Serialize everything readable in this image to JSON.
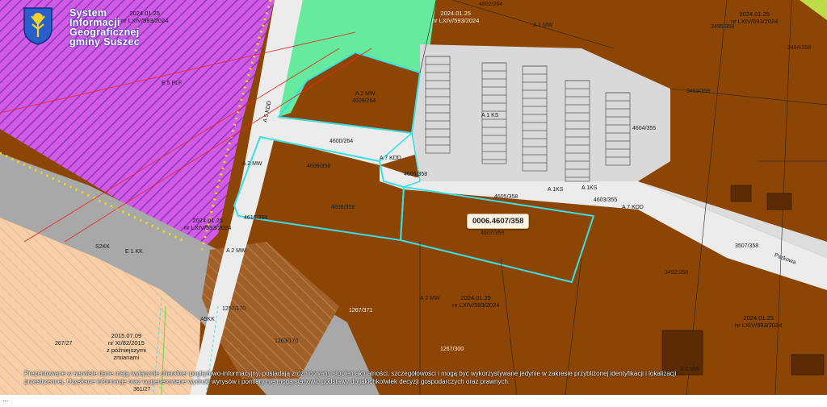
{
  "header": {
    "logo_lines": [
      "System",
      "Informacji",
      "Geograficznej",
      "gminy Suszec"
    ]
  },
  "tooltip": {
    "text": "0006.4607/358"
  },
  "disclaimer": {
    "text": "Prezentowane w serwisie dane mają wyłącznie charakter poglądowo-informacyjny, posiadają zróżnicowany stopień aktualności, szczegółowości i mogą być wykorzystywane jedynie w zakresie przybliżonej identyfikacji i lokalizacji przestrzennej. Uzyskane informacje oraz wygenerowane wydruki wyrysów i pomiary nie mogą stanowić podstawy do jakichkolwiek decyzji gospodarczych oraz prawnych."
  },
  "status": {
    "text": "..."
  },
  "colors": {
    "agricultural_brown": "#8c4504",
    "residential_green": "#66ea9e",
    "parking_gray": "#d9d9d9",
    "road_white": "#ececec",
    "magenta_zone": "#d15be6",
    "salmon_zone": "#f4c7a0",
    "gray_band": "#a9a9a9",
    "parcel_highlight": "#3fe3e6",
    "cyan_outline": "#39dfe4"
  },
  "map_labels": {
    "resolutions": [
      {
        "date": "2024.01.25",
        "ref": "nr LXIV/593/2024"
      },
      {
        "date": "2024.01.25",
        "ref": "nr LXIV/593/2024"
      },
      {
        "date": "2024.01.25",
        "ref": "nr LXIV/593/2024"
      },
      {
        "date": "2024.01.25",
        "ref": "nr LXIV/593/2024"
      },
      {
        "date": "2024.01.25",
        "ref": "nr LXIV/593/2024"
      },
      {
        "date": "2024.01.25",
        "ref": "nr LXIV/593/2024"
      }
    ],
    "old_resolution": {
      "date": "2015.07.09",
      "ref": "nr XI/82/2015",
      "note1": "z późniejszymi",
      "note2": "zmianami"
    },
    "zones": {
      "a1mw_top": "A 1 MW",
      "a2mw": "A 2 MW",
      "a2mw_left": "A 2 MW",
      "a2mw_mid": "A 2 MW",
      "a2mw_bottom": "A 2 MW",
      "a7kdd": "A 7 KDD",
      "a7kdd_right": "A 7 KDD",
      "a1ks": "A 1KS",
      "a1ks_2": "A 1KS",
      "a1ks_3": "A 1 KS",
      "a2mw_right": "A 2 MW",
      "a5kdd": "A 5 KDD",
      "e1kk": "E 1 KK",
      "e5plf": "E 5 PLF",
      "a5kk": "A5KK",
      "s2kk": "S2KK"
    },
    "parcels": {
      "p4602_264": "4602/264",
      "p4600_264": "4600/264",
      "p4605_358": "4605/358",
      "p4605_358b": "4605/358",
      "p4603_355": "4603/355",
      "p4604_355": "4604/355",
      "p4606_358": "4606/358",
      "p4607_358": "4607/358",
      "p4608_358": "4608/358",
      "p4609_264": "4609/264",
      "p3507_358": "3507/358",
      "p3495_358": "3495/358",
      "p3494_358": "3494/358",
      "p3493_358": "3493/358",
      "p3492_358": "3492/358",
      "p1267_371": "1267/371",
      "p1267_300": "1267/300",
      "p1257_170": "1257/170",
      "p1263_170": "1263/170",
      "p267_27": "267/27",
      "p361_27": "361/27",
      "p4610_358": "4610/358",
      "street_pszkowa": "Pszkowa"
    }
  }
}
